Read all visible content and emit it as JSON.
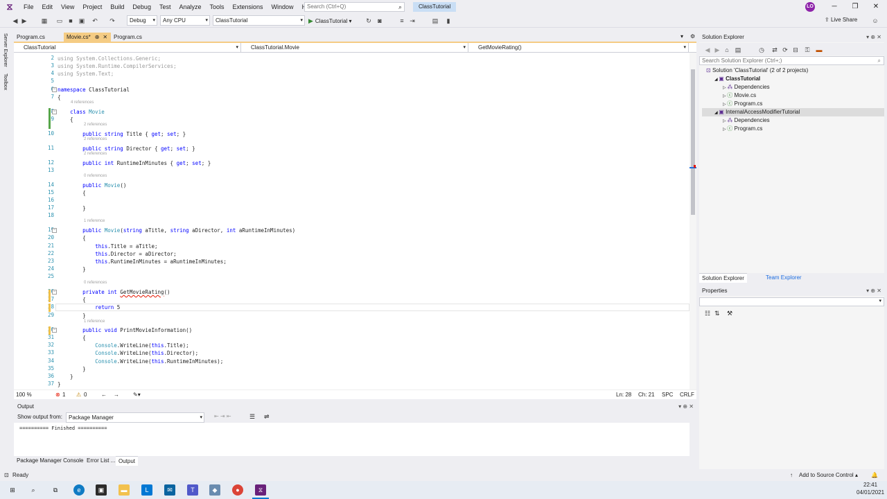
{
  "menu": {
    "items": [
      "File",
      "Edit",
      "View",
      "Project",
      "Build",
      "Debug",
      "Test",
      "Analyze",
      "Tools",
      "Extensions",
      "Window",
      "Help"
    ],
    "search_placeholder": "Search (Ctrl+Q)",
    "solution_name": "ClassTutorial",
    "avatar_initials": "LO"
  },
  "toolbar": {
    "config": "Debug",
    "platform": "Any CPU",
    "startup_project": "ClassTutorial",
    "run_label": "ClassTutorial",
    "live_share": "Live Share"
  },
  "left_strip": [
    "Server Explorer",
    "Toolbox"
  ],
  "doc_tabs": [
    {
      "label": "Program.cs"
    },
    {
      "label": "Movie.cs*"
    },
    {
      "label": "Program.cs"
    }
  ],
  "nav_bar": {
    "project": "ClassTutorial",
    "type": "ClassTutorial.Movie",
    "member": "GetMovieRating()"
  },
  "editor": {
    "lines": [
      {
        "n": "2",
        "text": "using System.Collections.Generic;"
      },
      {
        "n": "3",
        "text": "using System.Runtime.CompilerServices;"
      },
      {
        "n": "4",
        "text": "using System.Text;"
      },
      {
        "n": "5",
        "text": ""
      },
      {
        "n": "6",
        "text": "namespace ClassTutorial"
      },
      {
        "n": "7",
        "text": "{"
      },
      {
        "n": "8",
        "text": "    class Movie"
      },
      {
        "n": "9",
        "text": "    {"
      },
      {
        "n": "10",
        "text": "        public string Title { get; set; }"
      },
      {
        "n": "11",
        "text": "        public string Director { get; set; }"
      },
      {
        "n": "12",
        "text": "        public int RuntimeInMinutes { get; set; }"
      },
      {
        "n": "13",
        "text": ""
      },
      {
        "n": "14",
        "text": "        public Movie()"
      },
      {
        "n": "15",
        "text": "        {"
      },
      {
        "n": "16",
        "text": ""
      },
      {
        "n": "17",
        "text": "        }"
      },
      {
        "n": "18",
        "text": ""
      },
      {
        "n": "19",
        "text": "        public Movie(string aTitle, string aDirector, int aRuntimeInMinutes)"
      },
      {
        "n": "20",
        "text": "        {"
      },
      {
        "n": "21",
        "text": "            this.Title = aTitle;"
      },
      {
        "n": "22",
        "text": "            this.Director = aDirector;"
      },
      {
        "n": "23",
        "text": "            this.RuntimeInMinutes = aRuntimeInMinutes;"
      },
      {
        "n": "24",
        "text": "        }"
      },
      {
        "n": "25",
        "text": ""
      },
      {
        "n": "26",
        "text": "        private int GetMovieRating()"
      },
      {
        "n": "27",
        "text": "        {"
      },
      {
        "n": "28",
        "text": "            return 5"
      },
      {
        "n": "29",
        "text": "        }"
      },
      {
        "n": "30",
        "text": "        public void PrintMovieInformation()"
      },
      {
        "n": "31",
        "text": "        {"
      },
      {
        "n": "32",
        "text": "            Console.WriteLine(this.Title);"
      },
      {
        "n": "33",
        "text": "            Console.WriteLine(this.Director);"
      },
      {
        "n": "34",
        "text": "            Console.WriteLine(this.RuntimeInMinutes);"
      },
      {
        "n": "35",
        "text": "        }"
      },
      {
        "n": "36",
        "text": "    }"
      },
      {
        "n": "37",
        "text": "}"
      }
    ],
    "codelens": [
      {
        "after": "7",
        "text": "4 references"
      },
      {
        "after": "9",
        "text": "2 references"
      },
      {
        "after": "10",
        "text": "2 references"
      },
      {
        "after": "11",
        "text": "2 references"
      },
      {
        "after": "13",
        "text": "0 references"
      },
      {
        "after": "18",
        "text": "1 reference"
      },
      {
        "after": "25",
        "text": "0 references"
      },
      {
        "after": "29",
        "text": "1 reference"
      }
    ],
    "zoom": "100 %",
    "errors": "1",
    "warnings": "0",
    "line": "Ln: 28",
    "col": "Ch: 21",
    "spc": "SPC",
    "eol": "CRLF"
  },
  "output": {
    "title": "Output",
    "show_from_label": "Show output from:",
    "source": "Package Manager",
    "text": "========== Finished ==========",
    "tabs": [
      "Package Manager Console",
      "Error List ...",
      "Output"
    ]
  },
  "solution_explorer": {
    "title": "Solution Explorer",
    "search_placeholder": "Search Solution Explorer (Ctrl+;)",
    "tree": [
      {
        "label": "Solution 'ClassTutorial' (2 of 2 projects)",
        "indent": 0,
        "bold": false
      },
      {
        "label": "ClassTutorial",
        "indent": 1,
        "bold": true
      },
      {
        "label": "Dependencies",
        "indent": 2,
        "bold": false
      },
      {
        "label": "Movie.cs",
        "indent": 2,
        "bold": false
      },
      {
        "label": "Program.cs",
        "indent": 2,
        "bold": false
      },
      {
        "label": "InternalAccessModifierTutorial",
        "indent": 1,
        "bold": false,
        "selected": true
      },
      {
        "label": "Dependencies",
        "indent": 2,
        "bold": false
      },
      {
        "label": "Program.cs",
        "indent": 2,
        "bold": false
      }
    ],
    "bottom_tabs": [
      "Solution Explorer",
      "Team Explorer"
    ]
  },
  "properties": {
    "title": "Properties"
  },
  "statusbar": {
    "status": "Ready",
    "source_control": "Add to Source Control"
  },
  "taskbar": {
    "time": "22:41",
    "date": "04/01/2021"
  }
}
